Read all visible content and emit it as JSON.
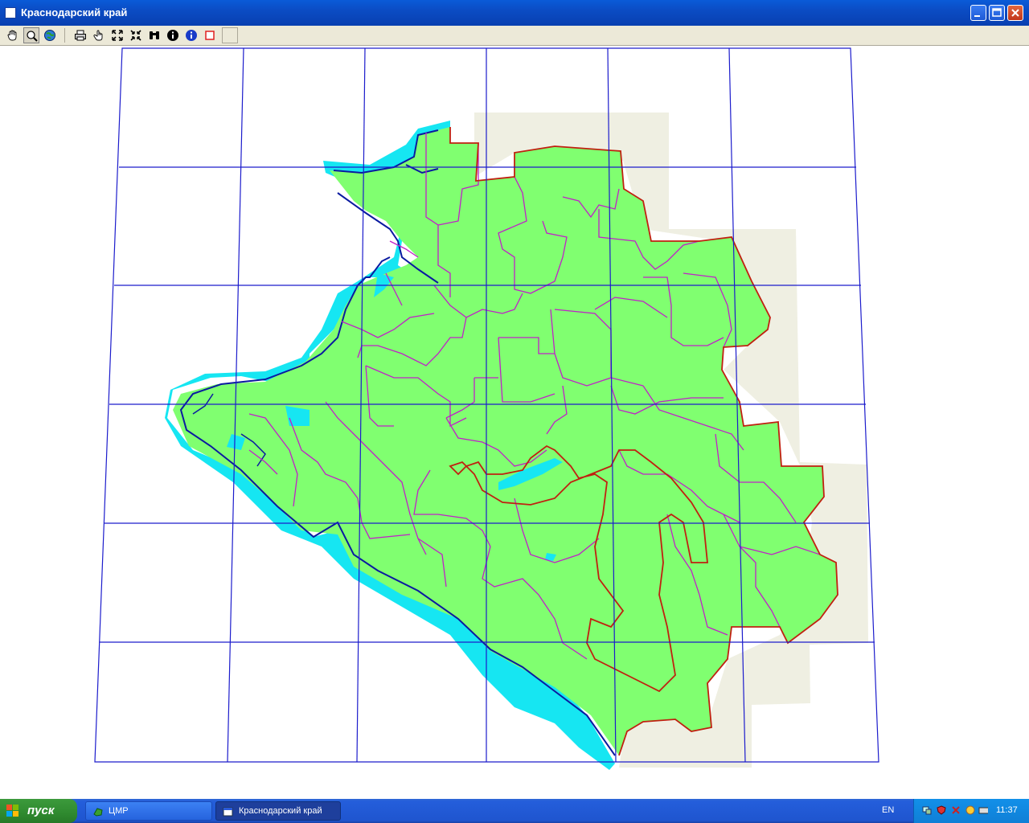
{
  "window": {
    "title": "Краснодарский край",
    "buttons": [
      "minimize",
      "maximize",
      "close"
    ]
  },
  "toolbar": {
    "tools": [
      {
        "name": "pan-hand-icon",
        "pressed": false
      },
      {
        "name": "zoom-icon",
        "pressed": true
      },
      {
        "name": "globe-icon",
        "pressed": false
      },
      {
        "name": "print-icon",
        "pressed": false
      },
      {
        "name": "select-hand-icon",
        "pressed": false
      },
      {
        "name": "zoom-extents-icon",
        "pressed": false
      },
      {
        "name": "zoom-shrink-icon",
        "pressed": false
      },
      {
        "name": "binoculars-icon",
        "pressed": false
      },
      {
        "name": "info-black-icon",
        "pressed": false
      },
      {
        "name": "info-blue-icon",
        "pressed": false
      },
      {
        "name": "stop-square-icon",
        "pressed": false
      }
    ]
  },
  "map": {
    "region": "Краснодарский край",
    "colors": {
      "land": "#80ff70",
      "sea_buffer": "#16e6f2",
      "coastline": "#0a1aa0",
      "district_border": "#c020c8",
      "regional_border": "#c02010",
      "grid": "#1c1ccc",
      "neighbor_area": "#efefe2"
    },
    "graticule": "on"
  },
  "taskbar": {
    "start_label": "пуск",
    "tasks": [
      {
        "label": "ЦМР",
        "icon": "map-app-icon",
        "active": false
      },
      {
        "label": "Краснодарский край",
        "icon": "window-app-icon",
        "active": true
      }
    ],
    "language": "EN",
    "clock": "11:37",
    "tray_icons": [
      "network-icon",
      "shield-icon",
      "antivirus-icon",
      "update-icon",
      "keyboard-icon"
    ]
  }
}
